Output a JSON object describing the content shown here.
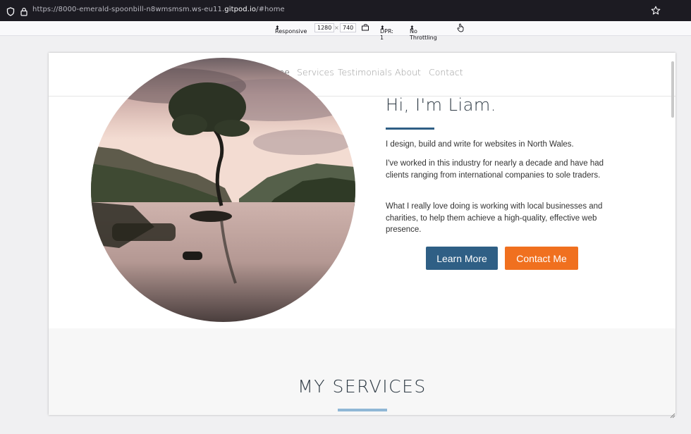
{
  "browser": {
    "url_prefix": "https://8000-emerald-spoonbill-n8wmsmsm.ws-eu11.",
    "url_domain": "gitpod.io",
    "url_suffix": "/#home"
  },
  "toolbar": {
    "mode": "Responsive",
    "width": "1280",
    "times": "×",
    "height": "740",
    "dpr": "DPR: 1",
    "throttling": "No Throttling"
  },
  "nav": {
    "items": [
      "Home",
      "Services",
      "Testimonials",
      "About",
      "Contact"
    ]
  },
  "hero": {
    "greeting": "Hi, I'm Liam.",
    "p1": "I design, build and write for websites in North Wales.",
    "p2": "I've worked in this industry for nearly a decade and have had clients ranging from international companies to sole traders.",
    "p3": "What I really love doing is working with local businesses and charities, to help them achieve a high-quality, effective web presence.",
    "btn_learn": "Learn More",
    "btn_contact": "Contact Me"
  },
  "services": {
    "heading": "MY SERVICES"
  },
  "colors": {
    "accent": "#2f5f85",
    "cta": "#f0701f"
  }
}
